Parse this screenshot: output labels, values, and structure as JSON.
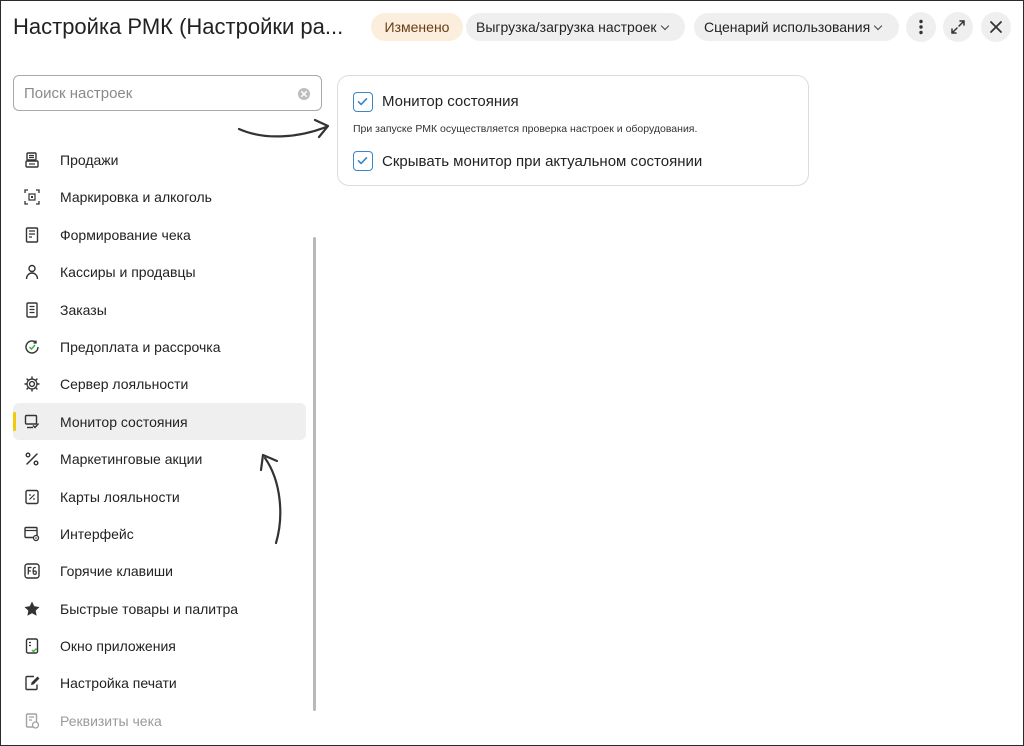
{
  "header": {
    "title": "Настройка РМК (Настройки ра...",
    "changed_badge": "Изменено",
    "export_label": "Выгрузка/загрузка настроек",
    "scenario_label": "Сценарий использования"
  },
  "search": {
    "placeholder": "Поиск настроек",
    "value": ""
  },
  "menu": {
    "items": [
      {
        "label": "Продажи",
        "icon": "cash-register-icon"
      },
      {
        "label": "Маркировка и алкоголь",
        "icon": "barcode-scan-icon"
      },
      {
        "label": "Формирование чека",
        "icon": "receipt-icon"
      },
      {
        "label": "Кассиры и продавцы",
        "icon": "user-icon"
      },
      {
        "label": "Заказы",
        "icon": "document-list-icon"
      },
      {
        "label": "Предоплата и рассрочка",
        "icon": "refresh-check-icon"
      },
      {
        "label": "Сервер лояльности",
        "icon": "gear-icon"
      },
      {
        "label": "Монитор состояния",
        "icon": "monitor-check-icon"
      },
      {
        "label": "Маркетинговые акции",
        "icon": "percent-icon"
      },
      {
        "label": "Карты лояльности",
        "icon": "discount-card-icon"
      },
      {
        "label": "Интерфейс",
        "icon": "interface-settings-icon"
      },
      {
        "label": "Горячие клавиши",
        "icon": "f6-key-icon"
      },
      {
        "label": "Быстрые товары и палитра",
        "icon": "star-icon"
      },
      {
        "label": "Окно приложения",
        "icon": "app-window-icon"
      },
      {
        "label": "Настройка печати",
        "icon": "print-edit-icon"
      },
      {
        "label": "Реквизиты чека",
        "icon": "receipt-details-icon"
      }
    ],
    "active_index": 7
  },
  "panel": {
    "monitor_label": "Монитор состояния",
    "monitor_checked": true,
    "description": "При запуске РМК осуществляется проверка настроек и оборудования.",
    "hide_label": "Скрывать монитор при актуальном состоянии",
    "hide_checked": true
  },
  "colors": {
    "accent": "#3a86c6",
    "active_marker": "#f3c90c",
    "changed_badge_bg": "#fbeedd",
    "changed_badge_text": "#6b3c14",
    "success_green": "#3bb54a"
  }
}
